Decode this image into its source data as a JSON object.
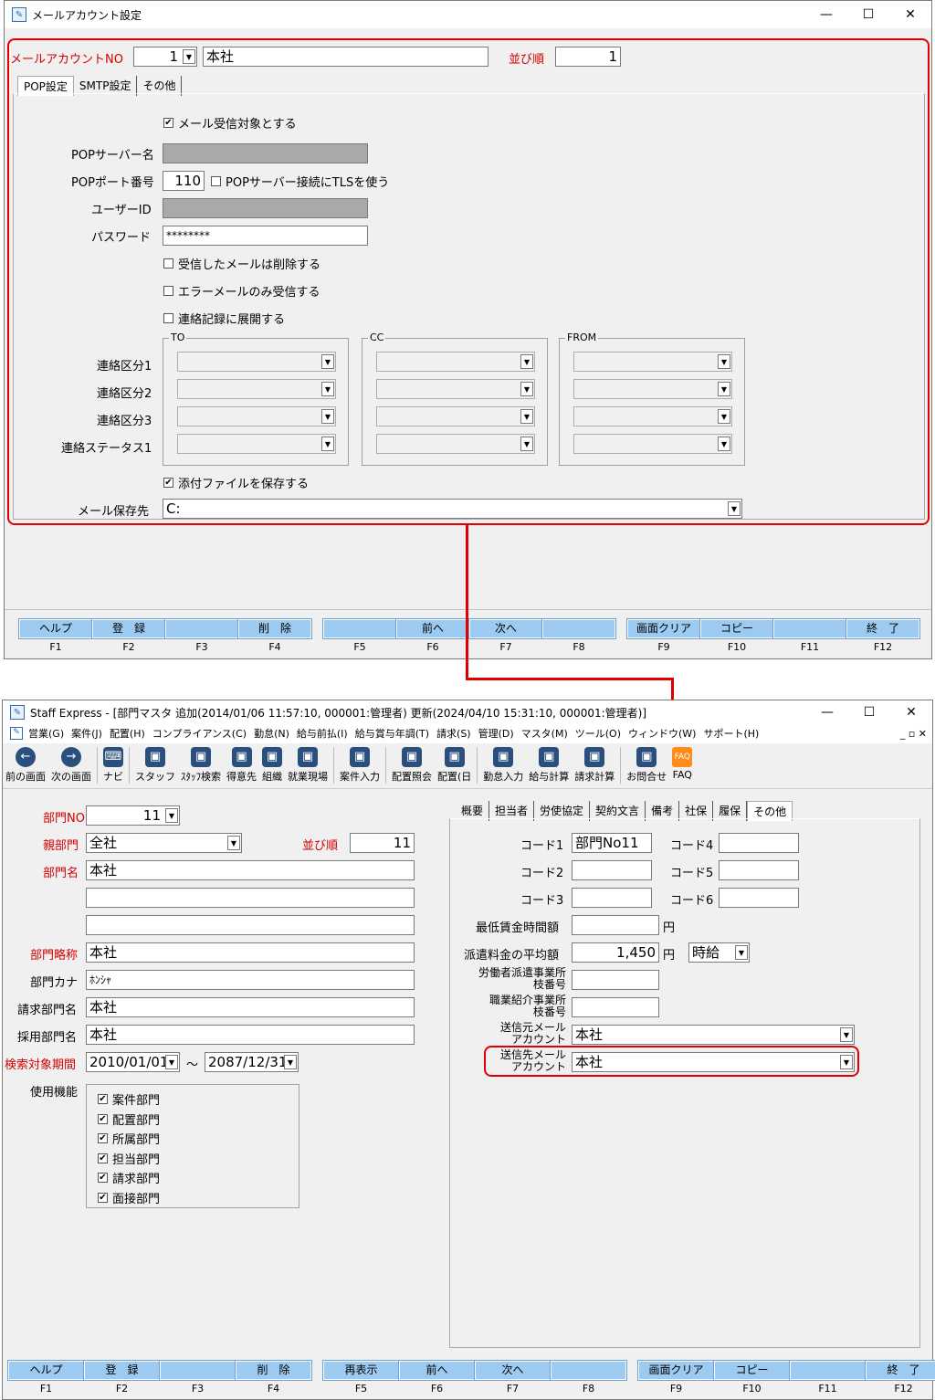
{
  "window1": {
    "title": "メールアカウント設定",
    "controls": {
      "min": "—",
      "max": "☐",
      "close": "✕"
    },
    "account_no_label": "メールアカウントNO",
    "account_no_value": "1",
    "account_name_value": "本社",
    "sort_label": "並び順",
    "sort_value": "1",
    "tabs": [
      "POP設定",
      "SMTP設定",
      "その他"
    ],
    "receive_target_label": "メール受信対象とする",
    "pop_server_label": "POPサーバー名",
    "pop_port_label": "POPポート番号",
    "pop_port_value": "110",
    "tls_label": "POPサーバー接続にTLSを使う",
    "user_id_label": "ユーザーID",
    "password_label": "パスワード",
    "password_value": "********",
    "delete_received_label": "受信したメールは削除する",
    "error_only_label": "エラーメールのみ受信する",
    "expand_log_label": "連絡記録に展開する",
    "group_to": "TO",
    "group_cc": "CC",
    "group_from": "FROM",
    "row_labels": [
      "連絡区分1",
      "連絡区分2",
      "連絡区分3",
      "連絡ステータス1"
    ],
    "save_attachment_label": "添付ファイルを保存する",
    "save_dest_label": "メール保存先",
    "save_dest_value": "C:",
    "fkeys": [
      {
        "label": "ヘルプ",
        "fn": "F1"
      },
      {
        "label": "登　録",
        "fn": "F2"
      },
      {
        "label": "",
        "fn": "F3"
      },
      {
        "label": "削　除",
        "fn": "F4"
      },
      {
        "label": "",
        "fn": "F5"
      },
      {
        "label": "前へ",
        "fn": "F6"
      },
      {
        "label": "次へ",
        "fn": "F7"
      },
      {
        "label": "",
        "fn": "F8"
      },
      {
        "label": "画面クリア",
        "fn": "F9"
      },
      {
        "label": "コピー",
        "fn": "F10"
      },
      {
        "label": "",
        "fn": "F11"
      },
      {
        "label": "終　了",
        "fn": "F12"
      }
    ]
  },
  "window2": {
    "title": "Staff Express - [部門マスタ  追加(2014/01/06 11:57:10, 000001:管理者)  更新(2024/04/10 15:31:10, 000001:管理者)]",
    "controls": {
      "min": "—",
      "max": "☐",
      "close": "✕"
    },
    "menu": [
      "営業(G)",
      "案件(J)",
      "配置(H)",
      "コンプライアンス(C)",
      "勤怠(N)",
      "給与前払(I)",
      "給与賞与年調(T)",
      "請求(S)",
      "管理(D)",
      "マスタ(M)",
      "ツール(O)",
      "ウィンドウ(W)",
      "サポート(H)"
    ],
    "toolbar": [
      {
        "label": "前の画面",
        "icon": "back-arrow"
      },
      {
        "label": "次の画面",
        "icon": "forward-arrow"
      },
      {
        "label": "ナビ",
        "icon": "keyboard"
      },
      {
        "label": "スタッフ",
        "icon": "staff"
      },
      {
        "label": "ｽﾀｯﾌ検索",
        "icon": "staff-search"
      },
      {
        "label": "得意先",
        "icon": "client"
      },
      {
        "label": "組織",
        "icon": "organization"
      },
      {
        "label": "就業現場",
        "icon": "workplace"
      },
      {
        "label": "案件入力",
        "icon": "case-entry"
      },
      {
        "label": "配置照会",
        "icon": "assignment-inquiry"
      },
      {
        "label": "配置(日",
        "icon": "assignment-daily"
      },
      {
        "label": "勤怠入力",
        "icon": "attendance"
      },
      {
        "label": "給与計算",
        "icon": "payroll"
      },
      {
        "label": "請求計算",
        "icon": "billing"
      },
      {
        "label": "お問合せ",
        "icon": "inquiry"
      },
      {
        "label": "FAQ",
        "icon": "faq"
      }
    ],
    "dept_no_label": "部門NO",
    "dept_no_value": "11",
    "parent_dept_label": "親部門",
    "parent_dept_value": "全社",
    "sort_label": "並び順",
    "sort_value": "11",
    "dept_name_label": "部門名",
    "dept_name_value": "本社",
    "dept_short_label": "部門略称",
    "dept_short_value": "本社",
    "dept_kana_label": "部門カナ",
    "dept_kana_value": "ﾎﾝｼｬ",
    "billing_dept_label": "請求部門名",
    "billing_dept_value": "本社",
    "hiring_dept_label": "採用部門名",
    "hiring_dept_value": "本社",
    "period_label": "検索対象期間",
    "period_from": "2010/01/01",
    "period_sep": "～",
    "period_to": "2087/12/31",
    "functions_label": "使用機能",
    "functions": [
      "案件部門",
      "配置部門",
      "所属部門",
      "担当部門",
      "請求部門",
      "面接部門"
    ],
    "tabs": [
      "概要",
      "担当者",
      "労使協定",
      "契約文言",
      "備考",
      "社保",
      "履保",
      "その他"
    ],
    "code1_label": "コード1",
    "code1_value": "部門No11",
    "code2_label": "コード2",
    "code3_label": "コード3",
    "code4_label": "コード4",
    "code5_label": "コード5",
    "code6_label": "コード6",
    "min_wage_label": "最低賃金時間額",
    "yen": "円",
    "avg_fee_label": "派遣料金の平均額",
    "avg_fee_value": "1,450",
    "fee_unit_value": "時給",
    "dispatch_branch_label_1": "労働者派遣事業所",
    "dispatch_branch_label_2": "枝番号",
    "placement_branch_label_1": "職業紹介事業所",
    "placement_branch_label_2": "枝番号",
    "sender_mail_label_1": "送信元メール",
    "sender_mail_label_2": "アカウント",
    "sender_mail_value": "本社",
    "dest_mail_label_1": "送信先メール",
    "dest_mail_label_2": "アカウント",
    "dest_mail_value": "本社",
    "fkeys": [
      {
        "label": "ヘルプ",
        "fn": "F1"
      },
      {
        "label": "登　録",
        "fn": "F2"
      },
      {
        "label": "",
        "fn": "F3"
      },
      {
        "label": "削　除",
        "fn": "F4"
      },
      {
        "label": "再表示",
        "fn": "F5"
      },
      {
        "label": "前へ",
        "fn": "F6"
      },
      {
        "label": "次へ",
        "fn": "F7"
      },
      {
        "label": "",
        "fn": "F8"
      },
      {
        "label": "画面クリア",
        "fn": "F9"
      },
      {
        "label": "コピー",
        "fn": "F10"
      },
      {
        "label": "",
        "fn": "F11"
      },
      {
        "label": "終　了",
        "fn": "F12"
      }
    ]
  },
  "colors": {
    "highlight": "#e00000",
    "fkey": "#9ccaf0",
    "required_label": "#d40000"
  }
}
